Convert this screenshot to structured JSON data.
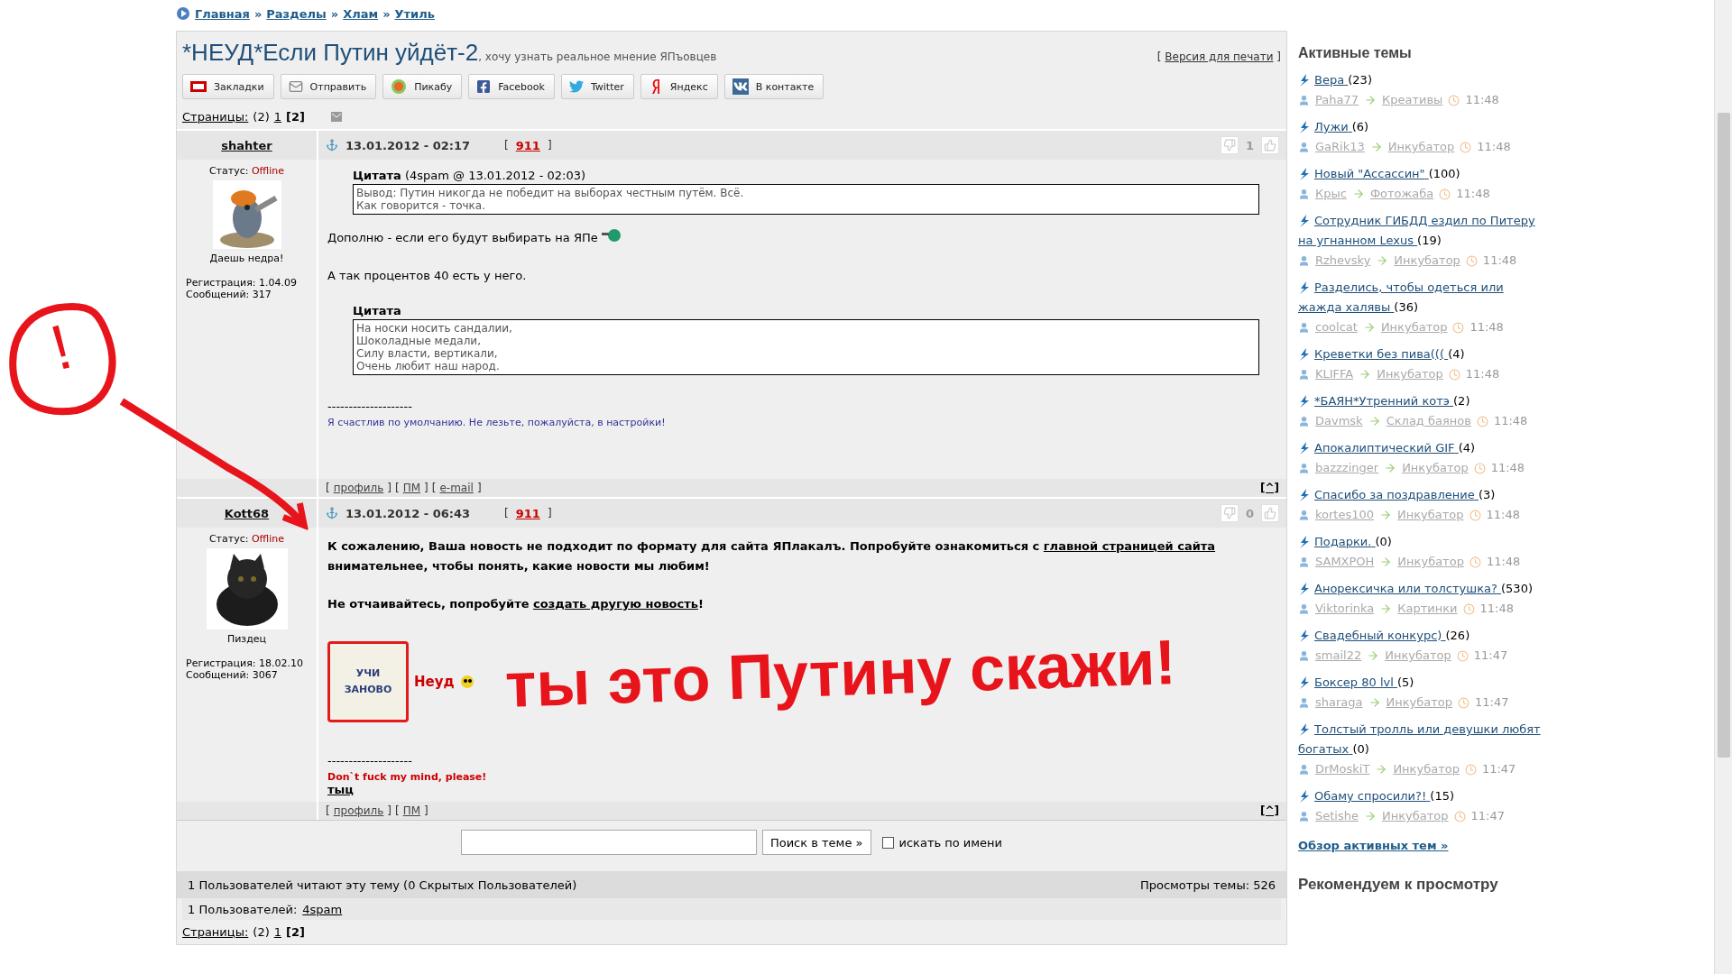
{
  "breadcrumb": {
    "separator": "»",
    "items": [
      {
        "label": "Главная"
      },
      {
        "label": "Разделы"
      },
      {
        "label": "Хлам"
      },
      {
        "label": "Утиль"
      }
    ]
  },
  "topic": {
    "title": "*НЕУД*Если Путин уйдёт-2",
    "subtitle": ", хочу узнать реальное мнение ЯПъовцев",
    "print_link": {
      "before": "[",
      "label": "Версия для печати",
      "after": "]"
    }
  },
  "share_buttons": [
    {
      "kind": "yap",
      "label": "Закладки"
    },
    {
      "kind": "mail",
      "label": "Отправить"
    },
    {
      "kind": "pikabu",
      "label": "Пикабу"
    },
    {
      "kind": "facebook",
      "label": "Facebook"
    },
    {
      "kind": "twitter",
      "label": "Twitter"
    },
    {
      "kind": "yandex",
      "label": "Яндекс"
    },
    {
      "kind": "vk",
      "label": "В контакте"
    }
  ],
  "pages_top": {
    "label": "Страницы:",
    "count": "(2)",
    "pages": [
      {
        "label": "1",
        "selected": false
      },
      {
        "label": "[2]",
        "selected": true
      }
    ]
  },
  "posts": [
    {
      "author": "shahter",
      "status_label": "Статус:",
      "status": "Offline",
      "avatar_caption": "Даешь недра!",
      "registration": "Регистрация: 1.04.09",
      "messages": "Сообщений: 317",
      "date": "13.01.2012 - 02:17",
      "number": {
        "before": "[",
        "label": "911",
        "after": "]"
      },
      "votes": "1",
      "body": [
        {
          "kind": "quote",
          "title": "Цитата",
          "meta": "(4spam @ 13.01.2012 - 02:03)",
          "lines": [
            "Вывод: Путин никогда не победит на выборах честным путём. Всё.",
            "Как говорится - точка."
          ]
        },
        {
          "kind": "paragraph",
          "bold": false,
          "emoticon": true,
          "parts": [
            {
              "text": "Дополню - если его будут выбирать на ЯПе",
              "link": false
            }
          ]
        },
        {
          "kind": "paragraph",
          "bold": false,
          "emoticon": false,
          "parts": [
            {
              "text": "А так процентов 40 есть у него.",
              "link": false
            }
          ]
        },
        {
          "kind": "quote",
          "title": "Цитата",
          "lines": [
            "На носки носить сандалии,",
            "Шоколадные медали,",
            "Силу власти, вертикали,",
            "Очень любит наш народ."
          ]
        },
        {
          "kind": "rule",
          "text": "--------------------"
        },
        {
          "kind": "signature",
          "text": "Я счастлив по умолчанию. Не лезьте, пожалуйста, в настройки!",
          "color": "#333399",
          "bold": false
        }
      ],
      "footer_links": [
        {
          "before": "[",
          "label": "профиль",
          "after": "]"
        },
        {
          "before": "[",
          "label": "ПМ",
          "after": "]"
        },
        {
          "before": "[",
          "label": "e-mail",
          "after": "]"
        }
      ],
      "top_link": "[^]"
    },
    {
      "author": "Kott68",
      "status_label": "Статус:",
      "status": "Offline",
      "avatar_caption": "Пиздец",
      "registration": "Регистрация: 18.02.10",
      "messages": "Сообщений: 3067",
      "date": "13.01.2012 - 06:43",
      "number": {
        "before": "[",
        "label": "911",
        "after": "]"
      },
      "votes": "0",
      "body": [
        {
          "kind": "paragraph",
          "bold": true,
          "emoticon": false,
          "parts": [
            {
              "text": "К сожалению, Ваша новость не подходит по формату для сайта ЯПлакалъ. Попробуйте ознакомиться с ",
              "link": false
            },
            {
              "text": "главной страницей сайта",
              "link": true
            },
            {
              "text": " внимательнее, чтобы понять, какие новости мы любим!",
              "link": false
            }
          ]
        },
        {
          "kind": "paragraph",
          "bold": true,
          "emoticon": false,
          "parts": [
            {
              "text": "Не отчаивайтесь, попробуйте ",
              "link": false
            },
            {
              "text": "создать другую новость",
              "link": true
            },
            {
              "text": "!",
              "link": false
            }
          ]
        },
        {
          "kind": "stamp",
          "lines": [
            "УЧИ",
            "ЗАНОВО"
          ],
          "verdict": "Неуд"
        },
        {
          "kind": "rule",
          "text": "--------------------"
        },
        {
          "kind": "signature",
          "text": "Don`t fuck my mind, please!",
          "color": "#cc0000",
          "bold": true
        },
        {
          "kind": "link",
          "text": "тыц"
        }
      ],
      "footer_links": [
        {
          "before": "[",
          "label": "профиль",
          "after": "]"
        },
        {
          "before": "[",
          "label": "ПМ",
          "after": "]"
        }
      ],
      "top_link": "[^]"
    }
  ],
  "search": {
    "button": "Поиск в теме »",
    "checkbox": {
      "label": "искать по имени",
      "checked": false
    }
  },
  "readers": {
    "summary": "1 Пользователей читают эту тему (0 Скрытых Пользователей)",
    "views": "Просмотры темы: 526",
    "users_label": "1 Пользователей:",
    "users": [
      "4spam"
    ]
  },
  "pages_bottom": {
    "label": "Страницы:",
    "count": "(2)",
    "pages": [
      {
        "label": "1",
        "selected": false
      },
      {
        "label": "[2]",
        "selected": true
      }
    ]
  },
  "sidebar": {
    "title": "Активные темы",
    "topics": [
      {
        "title": "Вера",
        "count": "(23)",
        "user": "Paha77",
        "section": "Креативы",
        "time": "11:48"
      },
      {
        "title": "Лужи",
        "count": "(6)",
        "user": "GaRik13",
        "section": "Инкубатор",
        "time": "11:48"
      },
      {
        "title": "Новый \"Ассассин\"",
        "count": "(100)",
        "user": "Крыс",
        "section": "Фотожаба",
        "time": "11:48"
      },
      {
        "title": "Сотрудник ГИБДД ездил по Питеру на угнанном Lexus",
        "count": "(19)",
        "user": "Rzhevsky",
        "section": "Инкубатор",
        "time": "11:48"
      },
      {
        "title": "Разделись, чтобы одеться или жажда халявы",
        "count": "(36)",
        "user": "coolcat",
        "section": "Инкубатор",
        "time": "11:48"
      },
      {
        "title": "Креветки без пива(((",
        "count": "(4)",
        "user": "KLIFFA",
        "section": "Инкубатор",
        "time": "11:48"
      },
      {
        "title": "*БАЯН*Утренний котэ",
        "count": "(2)",
        "user": "Davmsk",
        "section": "Склад баянов",
        "time": "11:48"
      },
      {
        "title": "Апокалиптический GIF",
        "count": "(4)",
        "user": "bazzzinger",
        "section": "Инкубатор",
        "time": "11:48"
      },
      {
        "title": "Спасибо за поздравление",
        "count": "(3)",
        "user": "kortes100",
        "section": "Инкубатор",
        "time": "11:48"
      },
      {
        "title": "Подарки.",
        "count": "(0)",
        "user": "SAMXPOH",
        "section": "Инкубатор",
        "time": "11:48"
      },
      {
        "title": "Анорексичка или толстушка?",
        "count": "(530)",
        "user": "Viktorinka",
        "section": "Картинки",
        "time": "11:48"
      },
      {
        "title": "Свадебный конкурс)",
        "count": "(26)",
        "user": "smail22",
        "section": "Инкубатор",
        "time": "11:47"
      },
      {
        "title": "Боксер 80 lvl",
        "count": "(5)",
        "user": "sharaga",
        "section": "Инкубатор",
        "time": "11:47"
      },
      {
        "title": "Толстый тролль или девушки любят богатых",
        "count": "(0)",
        "user": "DrMoskiT",
        "section": "Инкубатор",
        "time": "11:47"
      },
      {
        "title": "Обаму спросили?!",
        "count": "(15)",
        "user": "Setishe",
        "section": "Инкубатор",
        "time": "11:47"
      }
    ],
    "more_link": "Обзор активных тем »",
    "recommend_title": "Рекомендуем к просмотру"
  },
  "annotation": {
    "mark": "!",
    "text": "ты это Путину скажи!"
  }
}
